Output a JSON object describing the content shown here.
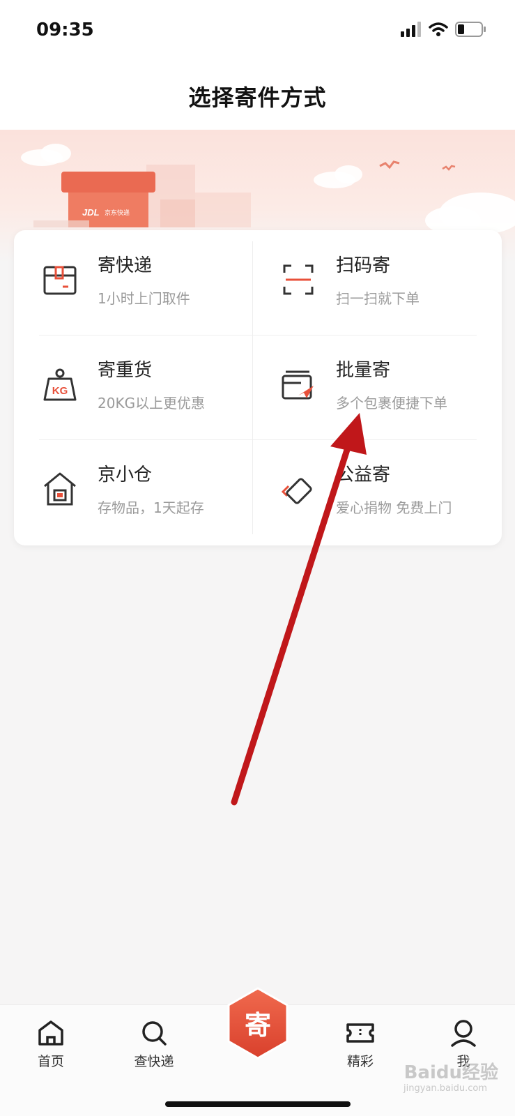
{
  "status_bar": {
    "time": "09:35"
  },
  "header": {
    "title": "选择寄件方式"
  },
  "banner": {
    "box_logo": "JDL",
    "box_text": "京东快递"
  },
  "services": [
    {
      "title": "寄快递",
      "subtitle": "1小时上门取件",
      "icon": "package-icon"
    },
    {
      "title": "扫码寄",
      "subtitle": "扫一扫就下单",
      "icon": "scan-icon"
    },
    {
      "title": "寄重货",
      "subtitle": "20KG以上更优惠",
      "icon": "weight-icon",
      "icon_text": "KG"
    },
    {
      "title": "批量寄",
      "subtitle": "多个包裹便捷下单",
      "icon": "batch-send-icon"
    },
    {
      "title": "京小仓",
      "subtitle": "存物品，1天起存",
      "icon": "warehouse-icon"
    },
    {
      "title": "公益寄",
      "subtitle": "爱心捐物 免费上门",
      "icon": "charity-icon"
    }
  ],
  "bottom_nav": {
    "home": "首页",
    "track": "查快递",
    "send": "寄",
    "featured": "精彩",
    "me": "我"
  },
  "watermark": {
    "brand": "Baidu经验",
    "domain": "jingyan.baidu.com"
  },
  "colors": {
    "accent": "#e8503a",
    "arrow": "#c0171a"
  }
}
